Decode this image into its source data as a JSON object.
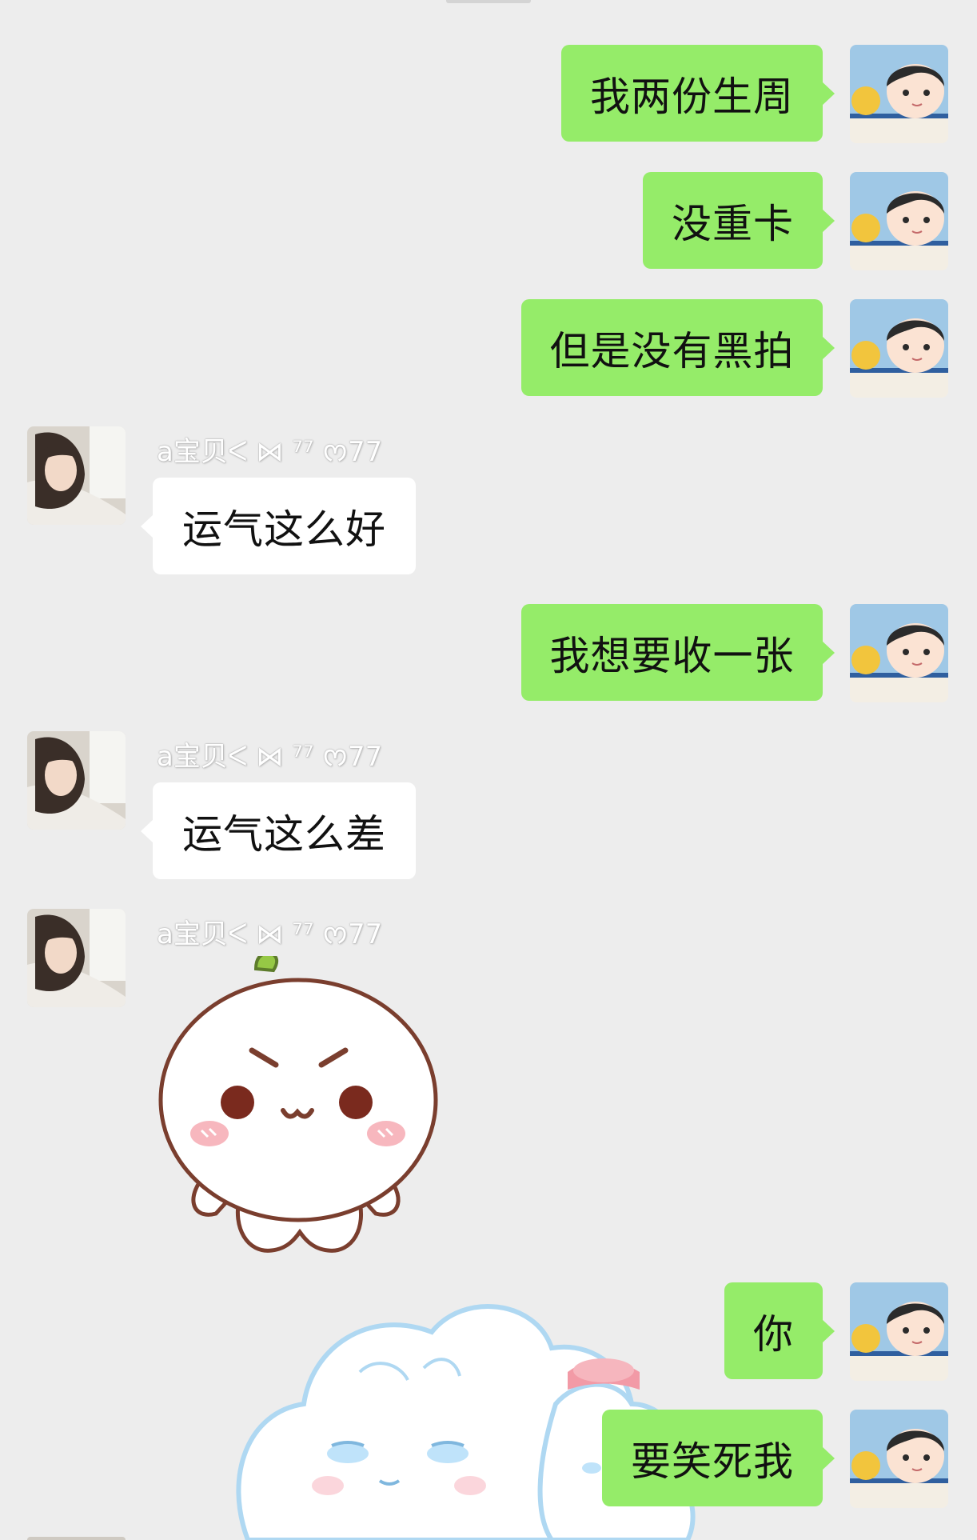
{
  "chat": {
    "friend_nickname": "a宝贝ᐸ ⋈ ⁷⁷ ᰔ77",
    "messages": [
      {
        "side": "out",
        "text": "我两份生周"
      },
      {
        "side": "out",
        "text": "没重卡"
      },
      {
        "side": "out",
        "text": "但是没有黑拍"
      },
      {
        "side": "in",
        "text": "运气这么好"
      },
      {
        "side": "out",
        "text": "我想要收一张"
      },
      {
        "side": "in",
        "text": "运气这么差"
      },
      {
        "side": "in",
        "sticker": "angry-white-bun-sticker"
      },
      {
        "side": "out",
        "text": "你"
      },
      {
        "side": "out",
        "text": "要笑死我"
      }
    ],
    "background_sticker": "crying-cloud-sticker"
  },
  "colors": {
    "background": "#EDEDED",
    "outgoing_bubble": "#95EC69",
    "incoming_bubble": "#FFFFFF"
  }
}
